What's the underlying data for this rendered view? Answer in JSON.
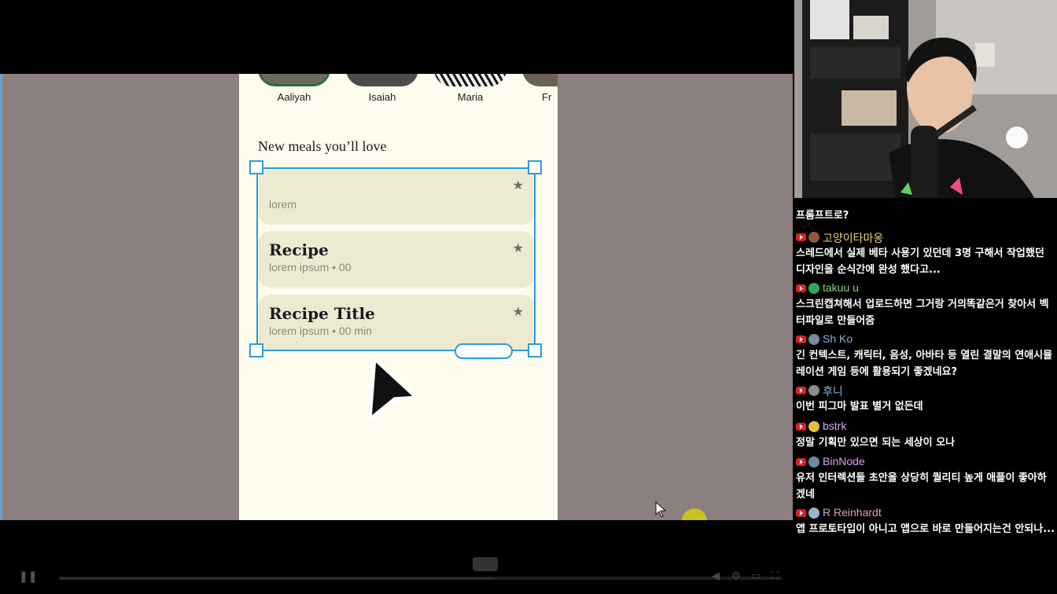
{
  "phone": {
    "contacts": [
      "Aaliyah",
      "Isaiah",
      "Maria",
      "Fr"
    ],
    "section_title": "New meals you’ll love",
    "cards": [
      {
        "title": "",
        "subtitle": "lorem"
      },
      {
        "title": "Recipe",
        "subtitle": "lorem ipsum • 00"
      },
      {
        "title": "Recipe Title",
        "subtitle": "lorem ipsum • 00 min"
      }
    ]
  },
  "icons": {
    "star": "star-icon",
    "cursor": "arrow-cursor-icon",
    "pause": "pause-icon"
  },
  "colors": {
    "selection": "#2b9be0",
    "canvas": "#8b7f80",
    "phone_bg": "#fdfcee",
    "card_bg": "#ecebd2",
    "youtube": "#e02020"
  },
  "chat": {
    "top_partial_text": "프롬프트로?",
    "messages": [
      {
        "user": "고양이타마옹",
        "color": "#f0d27a",
        "avatar": "#8a5a3a",
        "text": "스레드에서 실제 베타 사용기 있던데 3명 구해서 작업했던 디자인을 순식간에 완성 했다고..."
      },
      {
        "user": "takuu u",
        "color": "#8fd18f",
        "avatar": "#2faa5a",
        "text": "스크린캡쳐해서 업로드하면 그거랑 거의똑같은거 찾아서 벡터파일로 만들어줌"
      },
      {
        "user": "Sh Ko",
        "color": "#8ab4e8",
        "avatar": "#7a8c9a",
        "text": "긴 컨텍스트, 캐릭터, 음성, 아바타 등 열린 결말의 연애시뮬레이션 게임 등에 활용되기 좋겠네요?"
      },
      {
        "user": "후니",
        "color": "#8ab4e8",
        "avatar": "#8a8a8a",
        "text": "이번 피그마 발표 별거 없든데"
      },
      {
        "user": "bstrk",
        "color": "#d6a8f0",
        "avatar": "#e0c040",
        "text": "정말 기획만 있으면 되는 세상이 오나"
      },
      {
        "user": "BinNode",
        "color": "#d6a8f0",
        "avatar": "#6a8aa0",
        "text": "유저 인터렉션들 초안을 상당히 퀄리티 높게 애플이 좋아하겠네"
      },
      {
        "user": "R Reinhardt",
        "color": "#e0a0c0",
        "avatar": "#a0b0d0",
        "text": "앱 프로토타입이 아니고 앱으로 바로 만들어지는건 안되나..."
      }
    ]
  }
}
